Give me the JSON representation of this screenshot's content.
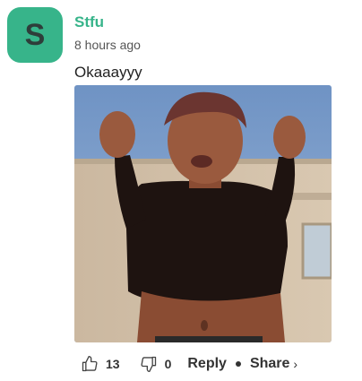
{
  "comment": {
    "avatar_letter": "S",
    "username": "Stfu",
    "timestamp": "8 hours ago",
    "text": "Okaaayyy"
  },
  "actions": {
    "likes": "13",
    "dislikes": "0",
    "reply_label": "Reply",
    "share_label": "Share",
    "share_chevron": "›"
  },
  "colors": {
    "accent": "#37b48a",
    "text": "#222222"
  }
}
